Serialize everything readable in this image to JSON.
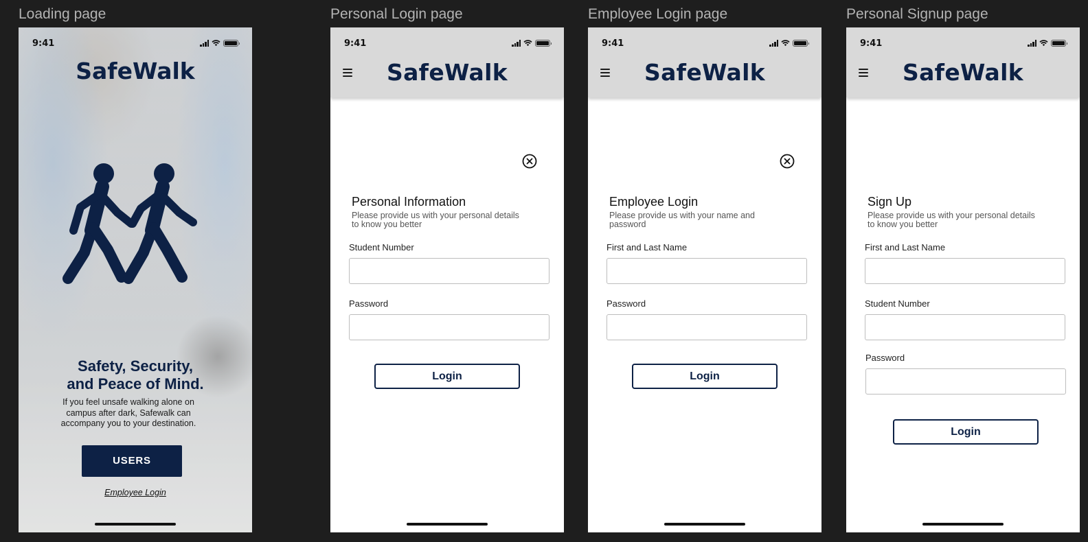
{
  "frames": {
    "loading": {
      "label": "Loading page",
      "time": "9:41",
      "brand": "SafeWalk",
      "tagline_line1": "Safety, Security,",
      "tagline_line2": "and Peace of Mind.",
      "description": "If you feel unsafe walking alone on campus after dark, Safewalk can accompany you to your destination.",
      "users_button": "USERS",
      "employee_link": "Employee Login"
    },
    "personal_login": {
      "label": "Personal Login page",
      "time": "9:41",
      "brand": "SafeWalk",
      "title": "Personal Information",
      "subtitle": "Please provide us with your personal details to know you better",
      "fields": [
        {
          "label": "Student Number",
          "value": ""
        },
        {
          "label": "Password",
          "value": ""
        }
      ],
      "button": "Login"
    },
    "employee_login": {
      "label": "Employee Login page",
      "time": "9:41",
      "brand": "SafeWalk",
      "title": "Employee Login",
      "subtitle": "Please provide us with your name and password",
      "fields": [
        {
          "label": "First and Last Name",
          "value": ""
        },
        {
          "label": "Password",
          "value": ""
        }
      ],
      "button": "Login"
    },
    "personal_signup": {
      "label": "Personal Signup page",
      "time": "9:41",
      "brand": "SafeWalk",
      "title": "Sign Up",
      "subtitle": "Please provide us with your personal details to know you better",
      "fields": [
        {
          "label": "First and Last Name",
          "value": ""
        },
        {
          "label": "Student Number",
          "value": ""
        },
        {
          "label": "Password",
          "value": ""
        }
      ],
      "button": "Login"
    }
  },
  "colors": {
    "brand_navy": "#0d2145",
    "header_gray": "#d9d9d9",
    "canvas": "#1e1e1e"
  }
}
